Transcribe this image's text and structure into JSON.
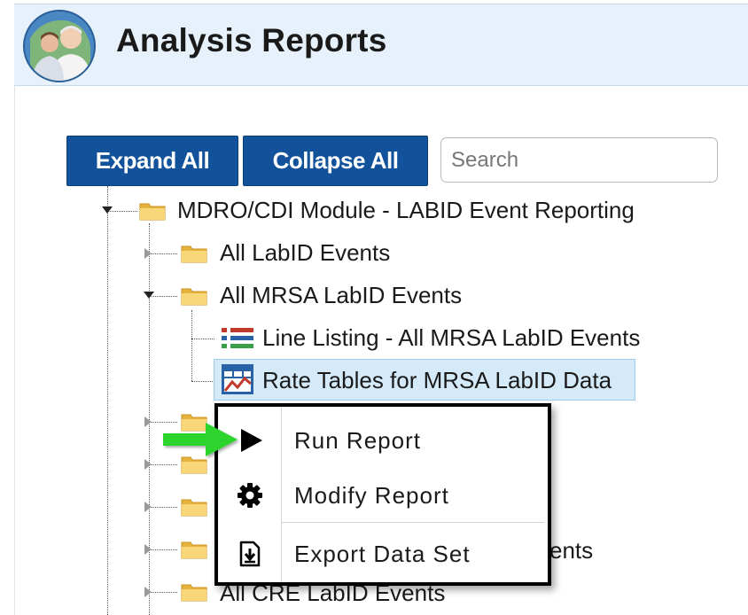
{
  "header": {
    "title": "Analysis Reports"
  },
  "toolbar": {
    "expand_all_label": "Expand All",
    "collapse_all_label": "Collapse All",
    "search_placeholder": "Search"
  },
  "tree": {
    "root": {
      "label": "MDRO/CDI Module - LABID Event Reporting",
      "icon": "folder-icon",
      "expanded": true
    },
    "children": [
      {
        "label": "All LabID Events",
        "icon": "folder-icon",
        "expanded": false
      },
      {
        "label": "All MRSA LabID Events",
        "icon": "folder-icon",
        "expanded": true
      },
      {
        "label": "",
        "icon": "folder-icon",
        "expanded": false
      },
      {
        "label": "",
        "icon": "folder-icon",
        "expanded": false
      },
      {
        "label": "",
        "icon": "folder-icon",
        "expanded": false
      },
      {
        "label_suffix": "ents",
        "icon": "folder-icon",
        "expanded": false
      },
      {
        "label": "All CRE LabID Events",
        "icon": "folder-icon",
        "expanded": false
      }
    ],
    "reports": [
      {
        "label": "Line Listing - All MRSA LabID Events",
        "icon": "line-listing-icon",
        "selected": false
      },
      {
        "label": "Rate Tables for MRSA LabID Data",
        "icon": "rate-table-icon",
        "selected": true
      }
    ]
  },
  "context_menu": {
    "items": [
      {
        "label": "Run Report",
        "icon": "play-icon"
      },
      {
        "label": "Modify Report",
        "icon": "gear-icon"
      },
      {
        "label": "Export Data Set",
        "icon": "export-icon"
      }
    ]
  },
  "colors": {
    "header_bg": "#e6f1fb",
    "button_bg": "#12529a",
    "selected_bg": "#d4eaf9",
    "callout_arrow": "#2fd42f",
    "folder": "#f2c94c"
  }
}
